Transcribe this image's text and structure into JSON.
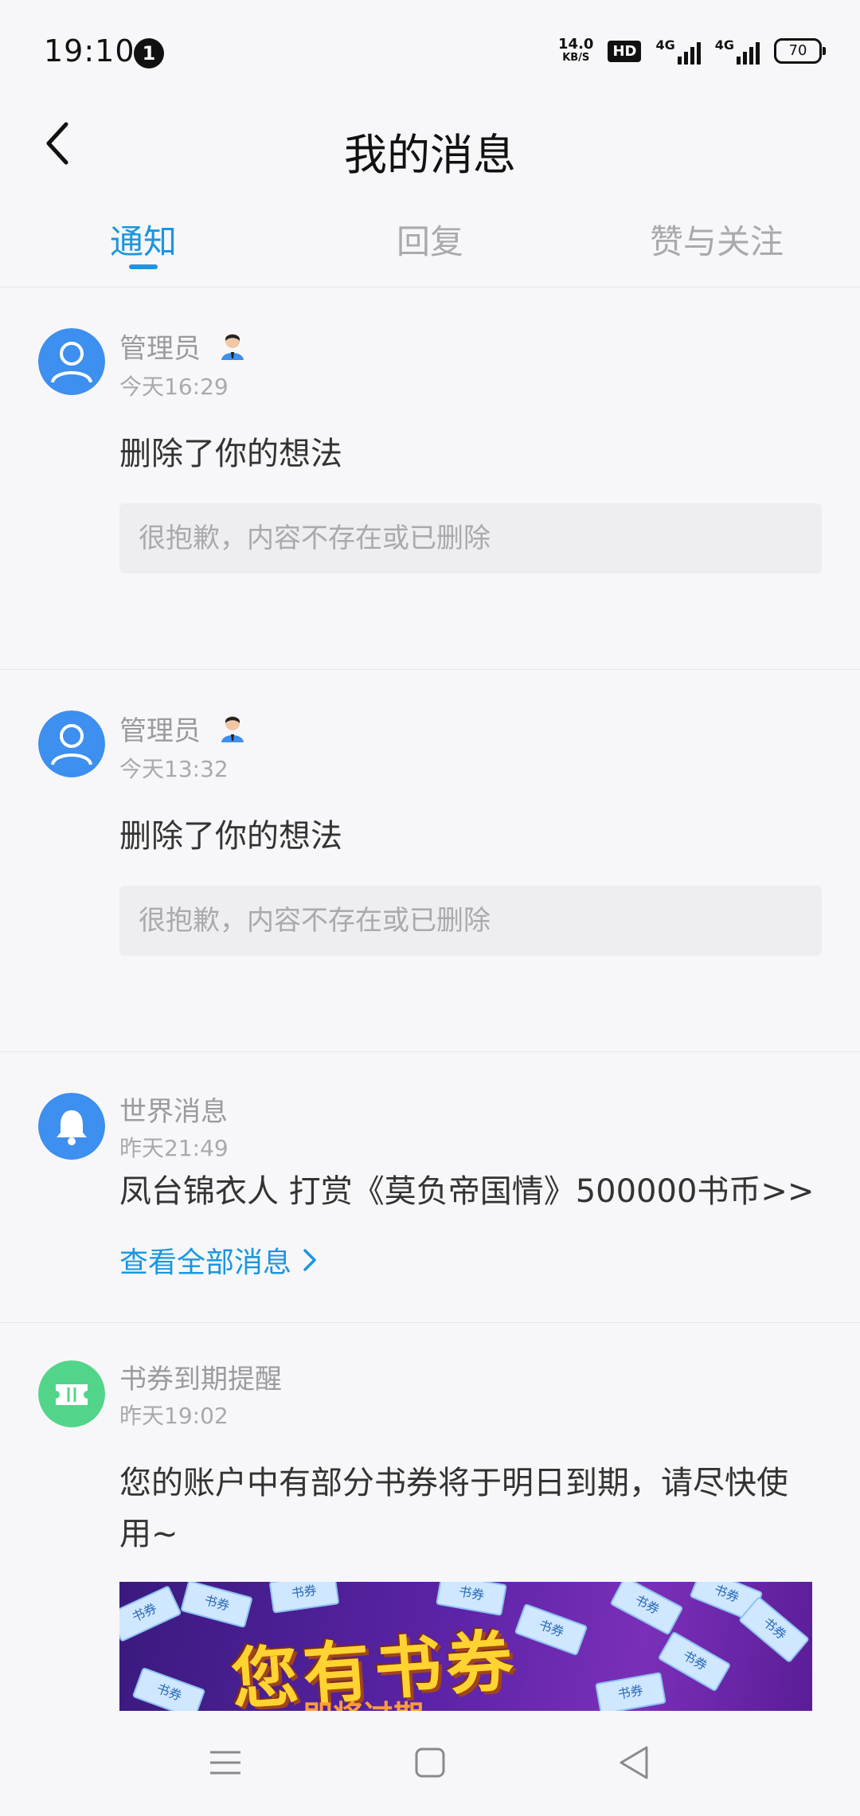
{
  "status_bar": {
    "time": "19:10",
    "notification_count": "1",
    "net_speed_value": "14.0",
    "net_speed_unit": "KB/S",
    "hd_label": "HD",
    "signal1_label": "4G",
    "signal2_label": "4G",
    "battery": "70"
  },
  "header": {
    "title": "我的消息",
    "back_icon": "chevron-left-icon"
  },
  "tabs": [
    {
      "label": "通知",
      "active": true
    },
    {
      "label": "回复",
      "active": false
    },
    {
      "label": "赞与关注",
      "active": false
    }
  ],
  "messages": [
    {
      "sender": "管理员",
      "time": "今天16:29",
      "content": "删除了你的想法",
      "quote": "很抱歉，内容不存在或已删除"
    },
    {
      "sender": "管理员",
      "time": "今天13:32",
      "content": "删除了你的想法",
      "quote": "很抱歉，内容不存在或已删除"
    },
    {
      "sender": "世界消息",
      "time": "昨天21:49",
      "content": "凤台锦衣人 打赏《莫负帝国情》500000书币>>",
      "link": "查看全部消息"
    },
    {
      "sender": "书券到期提醒",
      "time": "昨天19:02",
      "content_line1": "您的账户中有部分书券将于明日到期，请尽快使",
      "content_line2": "用~",
      "banner_title": "您有书券",
      "banner_sub": "即将过期",
      "ticket_label": "书券"
    }
  ],
  "colors": {
    "accent": "#1a96e0",
    "avatar_blue": "#3d8ff0",
    "avatar_green": "#52d58a",
    "background": "#f7f7f9"
  },
  "nav_icons": [
    "menu-icon",
    "home-square-icon",
    "back-triangle-icon"
  ]
}
